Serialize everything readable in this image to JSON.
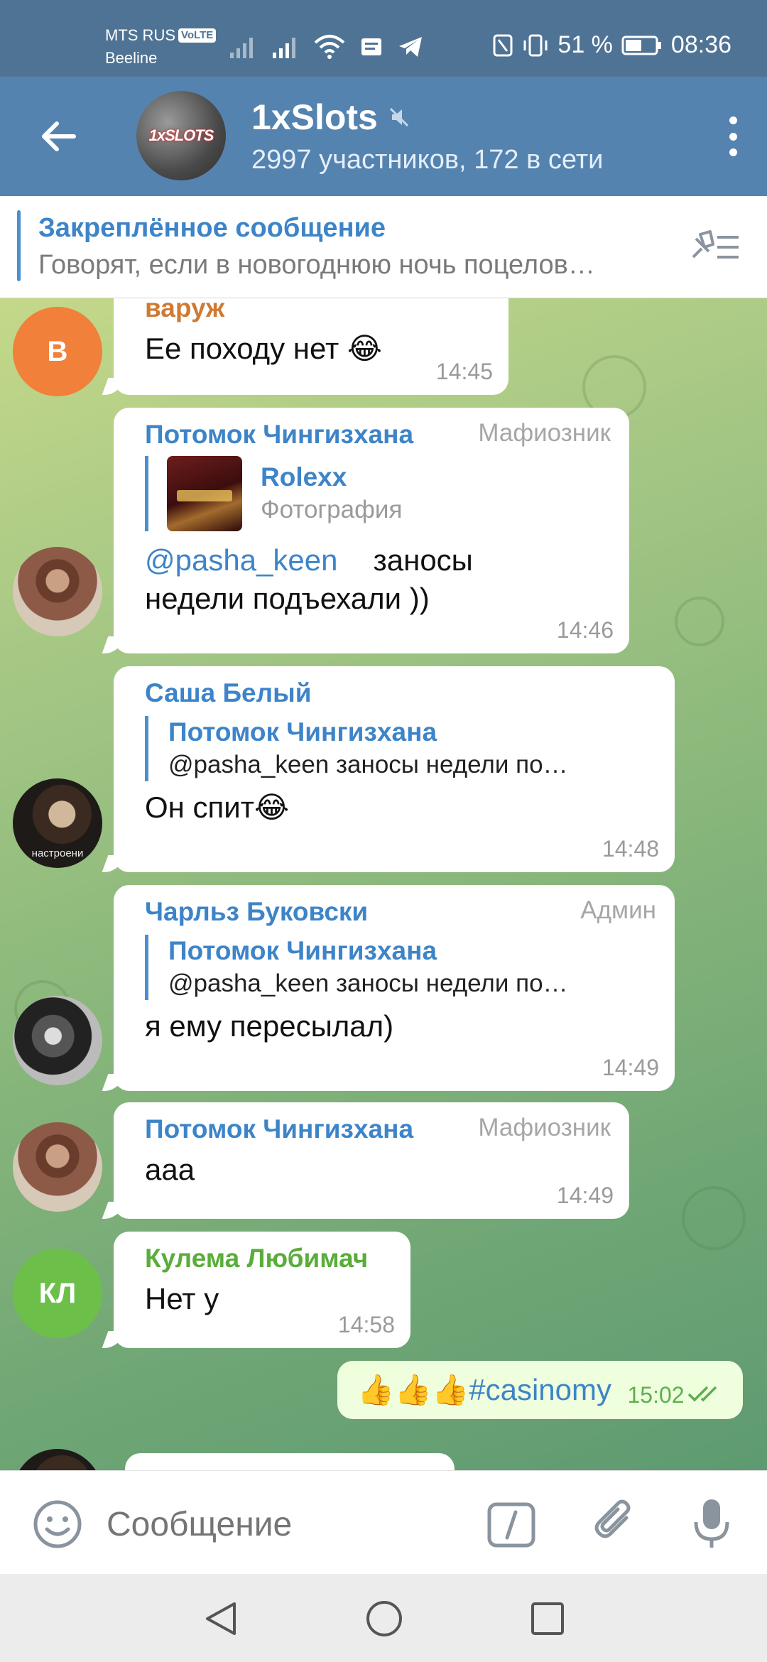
{
  "status_bar": {
    "carrier1": "MTS RUS",
    "volte": "VoLTE",
    "carrier2": "Beeline",
    "battery_pct": "51 %",
    "time": "08:36"
  },
  "header": {
    "title": "1xSlots",
    "avatar_text": "1xSLOTS",
    "subtitle": "2997 участников, 172 в сети",
    "muted": true
  },
  "pinned": {
    "title": "Закреплённое сообщение",
    "text": "Говорят, если в новогоднюю ночь поцелов…"
  },
  "messages": [
    {
      "sender": "варуж",
      "sender_color": "#cf7a33",
      "avatar_letter": "В",
      "avatar_color": "#f0803a",
      "text": "Ее походу нет 😂",
      "time": "14:45"
    },
    {
      "sender": "Потомок Чингизхана",
      "role": "Мафиозник",
      "reply_name": "Rolexx",
      "reply_text": "Фотография",
      "mention": "@pasha_keen",
      "text_after_mention": "заносы",
      "text_line2": "недели подъехали ))",
      "time": "14:46"
    },
    {
      "sender": "Саша Белый",
      "reply_name": "Потомок Чингизхана",
      "reply_text": "@pasha_keen   заносы недели по…",
      "text": "Он спит😂",
      "time": "14:48",
      "avatar_caption": "настроени"
    },
    {
      "sender": "Чарльз Буковски",
      "role": "Админ",
      "reply_name": "Потомок Чингизхана",
      "reply_text": "@pasha_keen   заносы недели по…",
      "text": "я ему пересылал)",
      "time": "14:49"
    },
    {
      "sender": "Потомок Чингизхана",
      "role": "Мафиозник",
      "text": "ааа",
      "time": "14:49"
    },
    {
      "sender": "Кулема Любимач",
      "sender_color": "#5aad3a",
      "avatar_letter": "КЛ",
      "avatar_color": "#6cc04a",
      "text": "Нет у",
      "time": "14:58"
    }
  ],
  "outgoing": {
    "text": "👍👍👍#casinomy",
    "time": "15:02"
  },
  "input": {
    "placeholder": "Сообщение"
  },
  "colors": {
    "header": "#5583b0",
    "status_bar": "#4f7394",
    "accent": "#3d84c8"
  }
}
